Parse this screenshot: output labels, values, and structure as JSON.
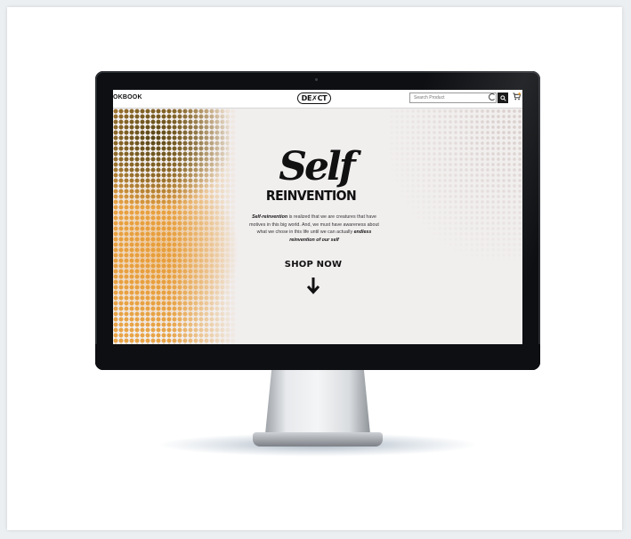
{
  "website": {
    "nav": {
      "lookbook_label": "OKBOOK",
      "logo_text": "DE✗CT",
      "search_placeholder": "Search Product"
    },
    "hero": {
      "title_word": "Self",
      "title_sub": "REINVENTION",
      "paragraph": {
        "part1_bold": "Self-reinvention",
        "part2": " is realized that we are creatures that have motives in this big world. And, we must have awareness about what we chose in this life until we can actually ",
        "part3_bold": "endless reinvention of our self"
      },
      "cta_label": "SHOP NOW"
    }
  },
  "colors": {
    "accent_orange": "#e6962a",
    "text_dark": "#111111",
    "bezel": "#0d0f12"
  },
  "icons": [
    "refresh-icon",
    "search-icon",
    "cart-icon",
    "arrow-down-icon"
  ]
}
